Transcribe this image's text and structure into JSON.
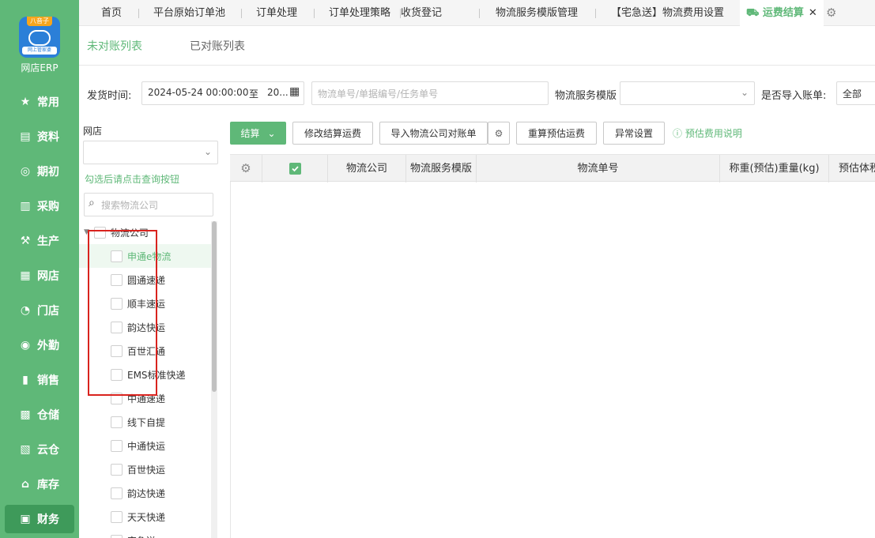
{
  "logo": {
    "badge": "八音子",
    "subtitle": "网上管家婆",
    "app_name": "网店ERP"
  },
  "sidebar": {
    "items": [
      {
        "label": "常用",
        "icon": "star-icon"
      },
      {
        "label": "资料",
        "icon": "document-icon"
      },
      {
        "label": "期初",
        "icon": "target-icon"
      },
      {
        "label": "采购",
        "icon": "purchase-icon"
      },
      {
        "label": "生产",
        "icon": "production-icon"
      },
      {
        "label": "网店",
        "icon": "store-icon"
      },
      {
        "label": "门店",
        "icon": "pie-icon"
      },
      {
        "label": "外勤",
        "icon": "field-icon"
      },
      {
        "label": "销售",
        "icon": "sales-chart-icon"
      },
      {
        "label": "仓储",
        "icon": "warehouse-icon"
      },
      {
        "label": "云仓",
        "icon": "cloud-warehouse-icon"
      },
      {
        "label": "库存",
        "icon": "inventory-icon"
      },
      {
        "label": "财务",
        "icon": "finance-icon"
      }
    ],
    "active_index": 12
  },
  "top_tabs": [
    "首页",
    "平台原始订单池",
    "订单处理",
    "订单处理策略",
    "收货登记",
    "物流服务模版管理",
    "【宅急送】物流费用设置",
    "运费结算"
  ],
  "active_top_tab": "运费结算",
  "sub_tabs": [
    "未对账列表",
    "已对账列表"
  ],
  "filters": {
    "ship_time_label": "发货时间:",
    "ship_time_start": "2024-05-24 00:00:00",
    "range_sep": "至",
    "ship_time_end": "20...",
    "search_placeholder": "物流单号/单据编号/任务单号",
    "template_label": "物流服务模版",
    "import_label": "是否导入账单:",
    "import_value": "全部"
  },
  "left_panel": {
    "store_label": "网店",
    "hint": "勾选后请点击查询按钮",
    "search_placeholder": "搜索物流公司",
    "root": "物流公司",
    "companies": [
      "申通e物流",
      "圆通速递",
      "顺丰速运",
      "韵达快运",
      "百世汇通",
      "EMS标准快递",
      "中通速递",
      "线下自提",
      "中通快运",
      "百世快运",
      "韵达快递",
      "天天快递",
      "宅急送"
    ],
    "selected_index": 0
  },
  "toolbar": {
    "settle": "结算",
    "modify_fee": "修改结算运费",
    "import_bill": "导入物流公司对账单",
    "recalc": "重算预估运费",
    "exception": "异常设置",
    "fee_info": "预估费用说明"
  },
  "grid": {
    "columns": [
      "物流公司",
      "物流服务模版",
      "物流单号",
      "称重(预估)重量(kg)",
      "预估体积"
    ]
  },
  "colors": {
    "brand": "#5fb878",
    "highlight": "#d9231e"
  }
}
